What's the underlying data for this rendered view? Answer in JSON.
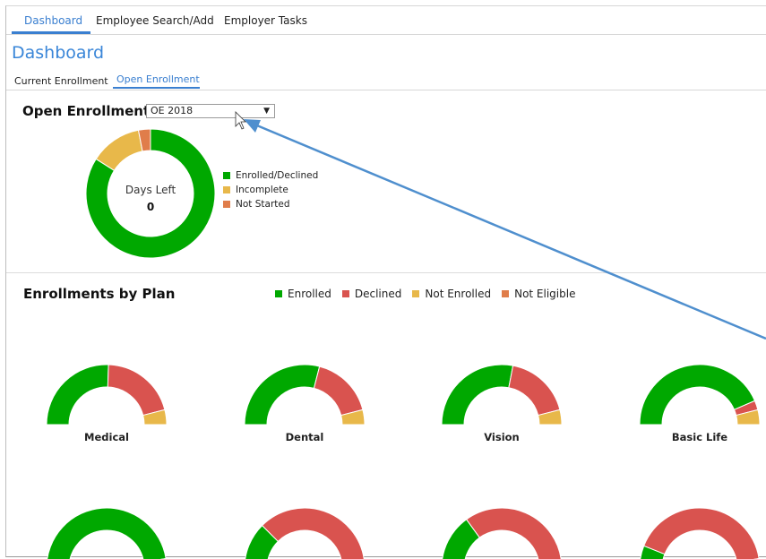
{
  "nav": {
    "tabs": [
      {
        "label": "Dashboard"
      },
      {
        "label": "Employee Search/Add"
      },
      {
        "label": "Employer Tasks"
      }
    ]
  },
  "page_title": "Dashboard",
  "subtabs": [
    {
      "label": "Current Enrollment"
    },
    {
      "label": "Open Enrollment"
    }
  ],
  "open_enrollment": {
    "title": "Open Enrollment",
    "selected_period": "OE 2018",
    "days_left_label": "Days Left",
    "days_left_value": "0",
    "legend": [
      {
        "label": "Enrolled/Declined",
        "color": "#00a800"
      },
      {
        "label": "Incomplete",
        "color": "#e8b84a"
      },
      {
        "label": "Not Started",
        "color": "#e07d4a"
      }
    ]
  },
  "plans": {
    "title": "Enrollments by Plan",
    "legend": [
      {
        "label": "Enrolled",
        "color": "#00a800"
      },
      {
        "label": "Declined",
        "color": "#d9534f"
      },
      {
        "label": "Not Enrolled",
        "color": "#e8b84a"
      },
      {
        "label": "Not Eligible",
        "color": "#e07d4a"
      }
    ],
    "labels": [
      "Medical",
      "Dental",
      "Vision",
      "Basic Life"
    ]
  },
  "chart_data": [
    {
      "type": "pie",
      "categories": [
        "Enrolled/Declined",
        "Incomplete",
        "Not Started"
      ],
      "values": [
        84,
        13,
        3
      ]
    },
    {
      "type": "pie",
      "categories": [
        "Enrolled",
        "Declined",
        "Not Enrolled",
        "Not Eligible"
      ],
      "values": [
        51,
        41,
        8,
        0
      ]
    },
    {
      "type": "pie",
      "categories": [
        "Enrolled",
        "Declined",
        "Not Enrolled",
        "Not Eligible"
      ],
      "values": [
        58,
        34,
        8,
        0
      ]
    },
    {
      "type": "pie",
      "categories": [
        "Enrolled",
        "Declined",
        "Not Enrolled",
        "Not Eligible"
      ],
      "values": [
        56,
        36,
        8,
        0
      ]
    },
    {
      "type": "pie",
      "categories": [
        "Enrolled",
        "Declined",
        "Not Enrolled",
        "Not Eligible"
      ],
      "values": [
        87,
        5,
        8,
        0
      ]
    },
    {
      "type": "pie",
      "categories": [
        "Enrolled",
        "Declined",
        "Not Enrolled",
        "Not Eligible"
      ],
      "values": [
        95,
        0,
        5,
        0
      ]
    },
    {
      "type": "pie",
      "categories": [
        "Enrolled",
        "Declined",
        "Not Enrolled",
        "Not Eligible"
      ],
      "values": [
        25,
        71,
        4,
        0
      ]
    },
    {
      "type": "pie",
      "categories": [
        "Enrolled",
        "Declined",
        "Not Enrolled",
        "Not Eligible"
      ],
      "values": [
        30,
        66,
        4,
        0
      ]
    },
    {
      "type": "pie",
      "categories": [
        "Enrolled",
        "Declined",
        "Not Enrolled",
        "Not Eligible"
      ],
      "values": [
        12,
        83,
        5,
        0
      ]
    }
  ]
}
